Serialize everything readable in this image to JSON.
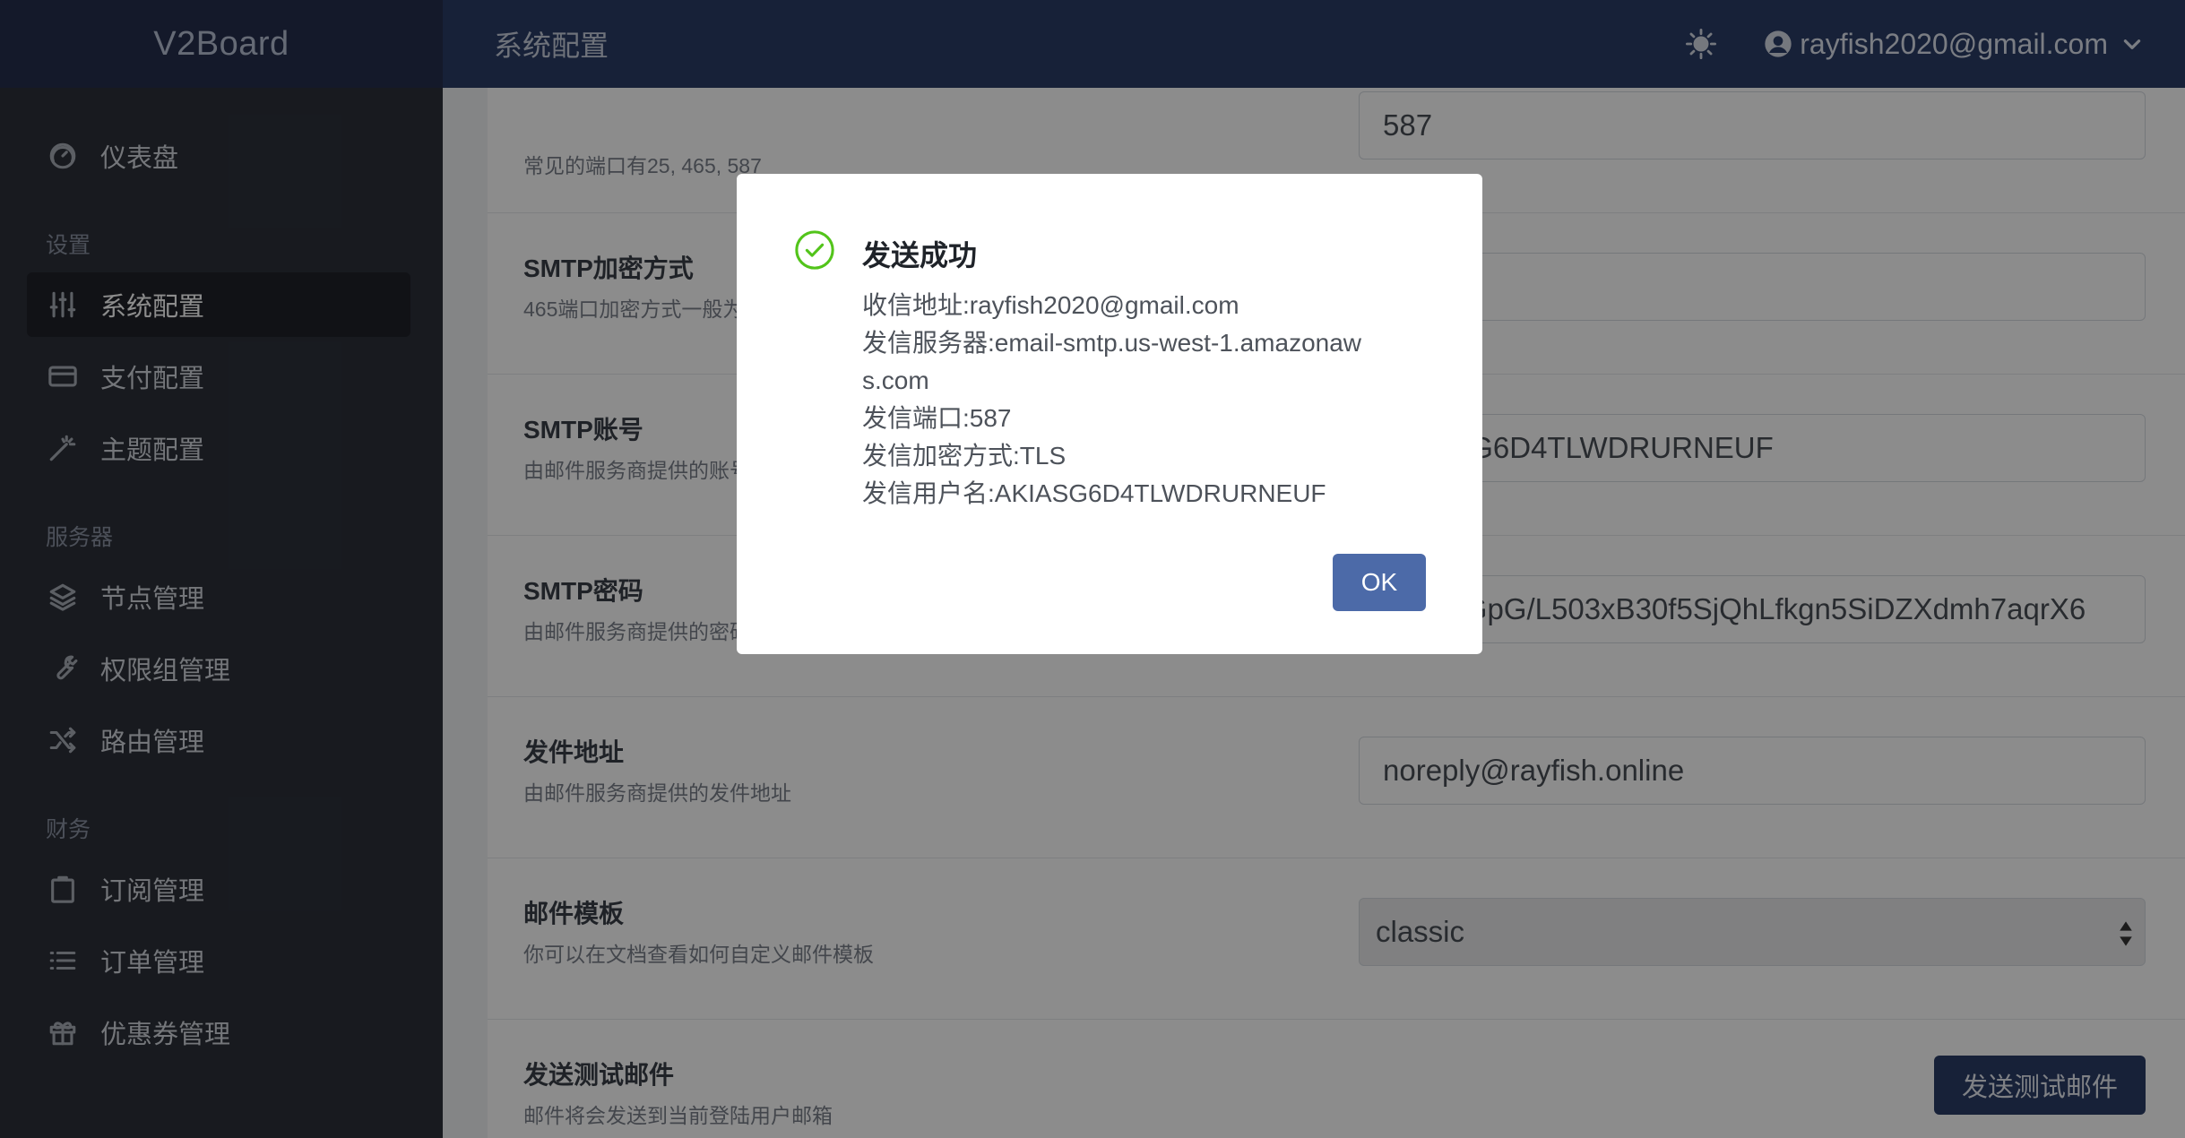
{
  "brand": "V2Board",
  "header": {
    "page_title": "系统配置",
    "user_email": "rayfish2020@gmail.com"
  },
  "sidebar": {
    "dashboard": "仪表盘",
    "groups": [
      {
        "heading": "设置",
        "items": [
          {
            "label": "系统配置",
            "icon": "sliders-icon",
            "active": true
          },
          {
            "label": "支付配置",
            "icon": "credit-card-icon",
            "active": false
          },
          {
            "label": "主题配置",
            "icon": "magic-wand-icon",
            "active": false
          }
        ]
      },
      {
        "heading": "服务器",
        "items": [
          {
            "label": "节点管理",
            "icon": "layers-icon",
            "active": false
          },
          {
            "label": "权限组管理",
            "icon": "wrench-icon",
            "active": false
          },
          {
            "label": "路由管理",
            "icon": "shuffle-icon",
            "active": false
          }
        ]
      },
      {
        "heading": "财务",
        "items": [
          {
            "label": "订阅管理",
            "icon": "clipboard-icon",
            "active": false
          },
          {
            "label": "订单管理",
            "icon": "list-icon",
            "active": false
          },
          {
            "label": "优惠券管理",
            "icon": "gift-icon",
            "active": false
          }
        ]
      }
    ]
  },
  "settings": {
    "port": {
      "desc": "常见的端口有25, 465, 587",
      "value": "587"
    },
    "encryption": {
      "label": "SMTP加密方式",
      "desc": "465端口加密方式一般为SSL，587端口加密方式一般为TLS",
      "value": ""
    },
    "account": {
      "label": "SMTP账号",
      "desc": "由邮件服务商提供的账号",
      "value": "AKIASG6D4TLWDRURNEUF"
    },
    "password": {
      "label": "SMTP密码",
      "desc": "由邮件服务商提供的密码",
      "value": "BMK+GpG/L503xB30f5SjQhLfkgn5SiDZXdmh7aqrX6"
    },
    "from": {
      "label": "发件地址",
      "desc": "由邮件服务商提供的发件地址",
      "value": "noreply@rayfish.online"
    },
    "template": {
      "label": "邮件模板",
      "desc": "你可以在文档查看如何自定义邮件模板",
      "value": "classic"
    },
    "test": {
      "label": "发送测试邮件",
      "desc": "邮件将会发送到当前登陆用户邮箱",
      "button": "发送测试邮件"
    }
  },
  "modal": {
    "title": "发送成功",
    "lines": [
      "收信地址:rayfish2020@gmail.com",
      "发信服务器:email-smtp.us-west-1.amazonaws.com",
      "发信端口:587",
      "发信加密方式:TLS",
      "发信用户名:AKIASG6D4TLWDRURNEUF"
    ],
    "ok": "OK"
  },
  "colors": {
    "header_bg": "#2b3c67",
    "sidebar_bg": "#2c313a",
    "primary_button": "#2b3c67",
    "ok_button": "#4c6aa8",
    "success_icon": "#52c41a"
  }
}
